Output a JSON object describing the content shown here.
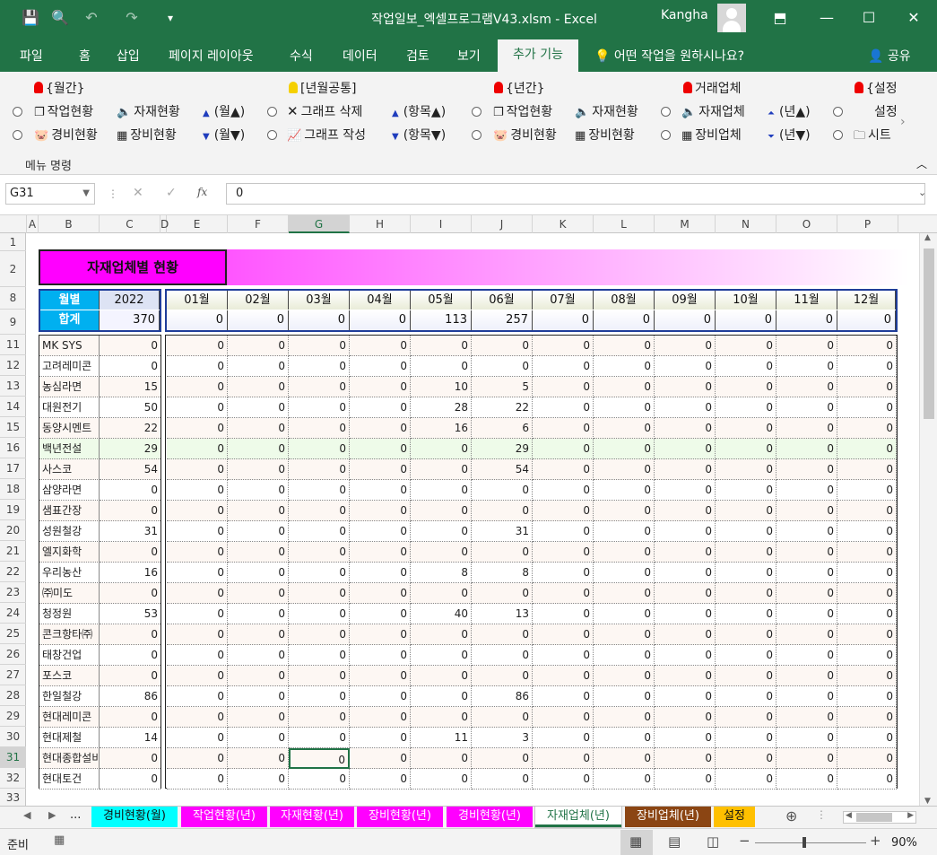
{
  "window": {
    "title": "작업일보_엑셀프로그램V43.xlsm  -  Excel",
    "user": "Kangha"
  },
  "menu": {
    "tabs": [
      "파일",
      "홈",
      "삽입",
      "페이지 레이아웃",
      "수식",
      "데이터",
      "검토",
      "보기"
    ],
    "active": "추가 기능",
    "tellme": "어떤 작업을 원하시나요?",
    "share": "공유"
  },
  "ribbon": {
    "group_label": "메뉴 명령",
    "headers": [
      "{월간}",
      "[년월공통]",
      "{년간}",
      "거래업체",
      "{설정"
    ],
    "row1": [
      "작업현황",
      "자재현황",
      "(월▲)",
      "그래프 삭제",
      "(항목▲)",
      "작업현황",
      "자재현황",
      "자재업체",
      "(년▲)",
      "설정"
    ],
    "row2": [
      "경비현황",
      "장비현황",
      "(월▼)",
      "그래프 작성",
      "(항목▼)",
      "경비현황",
      "장비현황",
      "장비업체",
      "(년▼)",
      "시트"
    ]
  },
  "formula_bar": {
    "name_box": "G31",
    "value": "0",
    "fx": "fx"
  },
  "columns": [
    "A",
    "B",
    "C",
    "D",
    "E",
    "F",
    "G",
    "H",
    "I",
    "J",
    "K",
    "L",
    "M",
    "N",
    "O",
    "P"
  ],
  "rows": [
    "1",
    "2",
    "8",
    "9",
    "11",
    "12",
    "13",
    "14",
    "15",
    "16",
    "17",
    "18",
    "19",
    "20",
    "21",
    "22",
    "23",
    "24",
    "25",
    "26",
    "27",
    "28",
    "29",
    "30",
    "31",
    "32",
    "33"
  ],
  "report": {
    "title": "자재업체별 현황",
    "label_month": "월별",
    "label_total": "합계",
    "year": "2022",
    "grand_total": "370",
    "months": [
      "01월",
      "02월",
      "03월",
      "04월",
      "05월",
      "06월",
      "07월",
      "08월",
      "09월",
      "10월",
      "11월",
      "12월"
    ],
    "month_totals": [
      "0",
      "0",
      "0",
      "0",
      "113",
      "257",
      "0",
      "0",
      "0",
      "0",
      "0",
      "0"
    ],
    "vendors": [
      {
        "name": "MK SYS",
        "total": "0",
        "m": [
          "0",
          "0",
          "0",
          "0",
          "0",
          "0",
          "0",
          "0",
          "0",
          "0",
          "0",
          "0"
        ]
      },
      {
        "name": "고려레미콘",
        "total": "0",
        "m": [
          "0",
          "0",
          "0",
          "0",
          "0",
          "0",
          "0",
          "0",
          "0",
          "0",
          "0",
          "0"
        ]
      },
      {
        "name": "농심라면",
        "total": "15",
        "m": [
          "0",
          "0",
          "0",
          "0",
          "10",
          "5",
          "0",
          "0",
          "0",
          "0",
          "0",
          "0"
        ]
      },
      {
        "name": "대원전기",
        "total": "50",
        "m": [
          "0",
          "0",
          "0",
          "0",
          "28",
          "22",
          "0",
          "0",
          "0",
          "0",
          "0",
          "0"
        ]
      },
      {
        "name": "동양시멘트",
        "total": "22",
        "m": [
          "0",
          "0",
          "0",
          "0",
          "16",
          "6",
          "0",
          "0",
          "0",
          "0",
          "0",
          "0"
        ]
      },
      {
        "name": "백년전설",
        "total": "29",
        "m": [
          "0",
          "0",
          "0",
          "0",
          "0",
          "29",
          "0",
          "0",
          "0",
          "0",
          "0",
          "0"
        ]
      },
      {
        "name": "사스코",
        "total": "54",
        "m": [
          "0",
          "0",
          "0",
          "0",
          "0",
          "54",
          "0",
          "0",
          "0",
          "0",
          "0",
          "0"
        ]
      },
      {
        "name": "삼양라면",
        "total": "0",
        "m": [
          "0",
          "0",
          "0",
          "0",
          "0",
          "0",
          "0",
          "0",
          "0",
          "0",
          "0",
          "0"
        ]
      },
      {
        "name": "샘표간장",
        "total": "0",
        "m": [
          "0",
          "0",
          "0",
          "0",
          "0",
          "0",
          "0",
          "0",
          "0",
          "0",
          "0",
          "0"
        ]
      },
      {
        "name": "성원철강",
        "total": "31",
        "m": [
          "0",
          "0",
          "0",
          "0",
          "0",
          "31",
          "0",
          "0",
          "0",
          "0",
          "0",
          "0"
        ]
      },
      {
        "name": "엘지화학",
        "total": "0",
        "m": [
          "0",
          "0",
          "0",
          "0",
          "0",
          "0",
          "0",
          "0",
          "0",
          "0",
          "0",
          "0"
        ]
      },
      {
        "name": "우리농산",
        "total": "16",
        "m": [
          "0",
          "0",
          "0",
          "0",
          "8",
          "8",
          "0",
          "0",
          "0",
          "0",
          "0",
          "0"
        ]
      },
      {
        "name": "㈜미도",
        "total": "0",
        "m": [
          "0",
          "0",
          "0",
          "0",
          "0",
          "0",
          "0",
          "0",
          "0",
          "0",
          "0",
          "0"
        ]
      },
      {
        "name": "청정원",
        "total": "53",
        "m": [
          "0",
          "0",
          "0",
          "0",
          "40",
          "13",
          "0",
          "0",
          "0",
          "0",
          "0",
          "0"
        ]
      },
      {
        "name": "콘크항타㈜",
        "total": "0",
        "m": [
          "0",
          "0",
          "0",
          "0",
          "0",
          "0",
          "0",
          "0",
          "0",
          "0",
          "0",
          "0"
        ]
      },
      {
        "name": "태창건업",
        "total": "0",
        "m": [
          "0",
          "0",
          "0",
          "0",
          "0",
          "0",
          "0",
          "0",
          "0",
          "0",
          "0",
          "0"
        ]
      },
      {
        "name": "포스코",
        "total": "0",
        "m": [
          "0",
          "0",
          "0",
          "0",
          "0",
          "0",
          "0",
          "0",
          "0",
          "0",
          "0",
          "0"
        ]
      },
      {
        "name": "한일철강",
        "total": "86",
        "m": [
          "0",
          "0",
          "0",
          "0",
          "0",
          "86",
          "0",
          "0",
          "0",
          "0",
          "0",
          "0"
        ]
      },
      {
        "name": "현대레미콘",
        "total": "0",
        "m": [
          "0",
          "0",
          "0",
          "0",
          "0",
          "0",
          "0",
          "0",
          "0",
          "0",
          "0",
          "0"
        ]
      },
      {
        "name": "현대제철",
        "total": "14",
        "m": [
          "0",
          "0",
          "0",
          "0",
          "11",
          "3",
          "0",
          "0",
          "0",
          "0",
          "0",
          "0"
        ]
      },
      {
        "name": "현대종합설비",
        "total": "0",
        "m": [
          "0",
          "0",
          "0",
          "0",
          "0",
          "0",
          "0",
          "0",
          "0",
          "0",
          "0",
          "0"
        ]
      },
      {
        "name": "현대토건",
        "total": "0",
        "m": [
          "0",
          "0",
          "0",
          "0",
          "0",
          "0",
          "0",
          "0",
          "0",
          "0",
          "0",
          "0"
        ]
      }
    ]
  },
  "sheet_tabs": [
    {
      "label": "경비현황(월)",
      "bg": "#00ffff",
      "fg": "#111"
    },
    {
      "label": "작업현황(년)",
      "bg": "#ff00ff",
      "fg": "#fff"
    },
    {
      "label": "자재현황(년)",
      "bg": "#ff00ff",
      "fg": "#fff"
    },
    {
      "label": "장비현황(년)",
      "bg": "#ff00ff",
      "fg": "#fff"
    },
    {
      "label": "경비현황(년)",
      "bg": "#ff00ff",
      "fg": "#fff"
    },
    {
      "label": "자재업체(년)",
      "bg": "#ffffff",
      "fg": "#217346"
    },
    {
      "label": "장비업체(년)",
      "bg": "#8b4513",
      "fg": "#fff"
    },
    {
      "label": "설정",
      "bg": "#ffc000",
      "fg": "#111"
    }
  ],
  "sheet_nav": {
    "more": "..."
  },
  "status": {
    "ready": "준비",
    "zoom": "90%"
  },
  "colors": {
    "excel_green": "#217346",
    "title_magenta": "#ff00ff",
    "header_fill": "#dde3f4"
  }
}
